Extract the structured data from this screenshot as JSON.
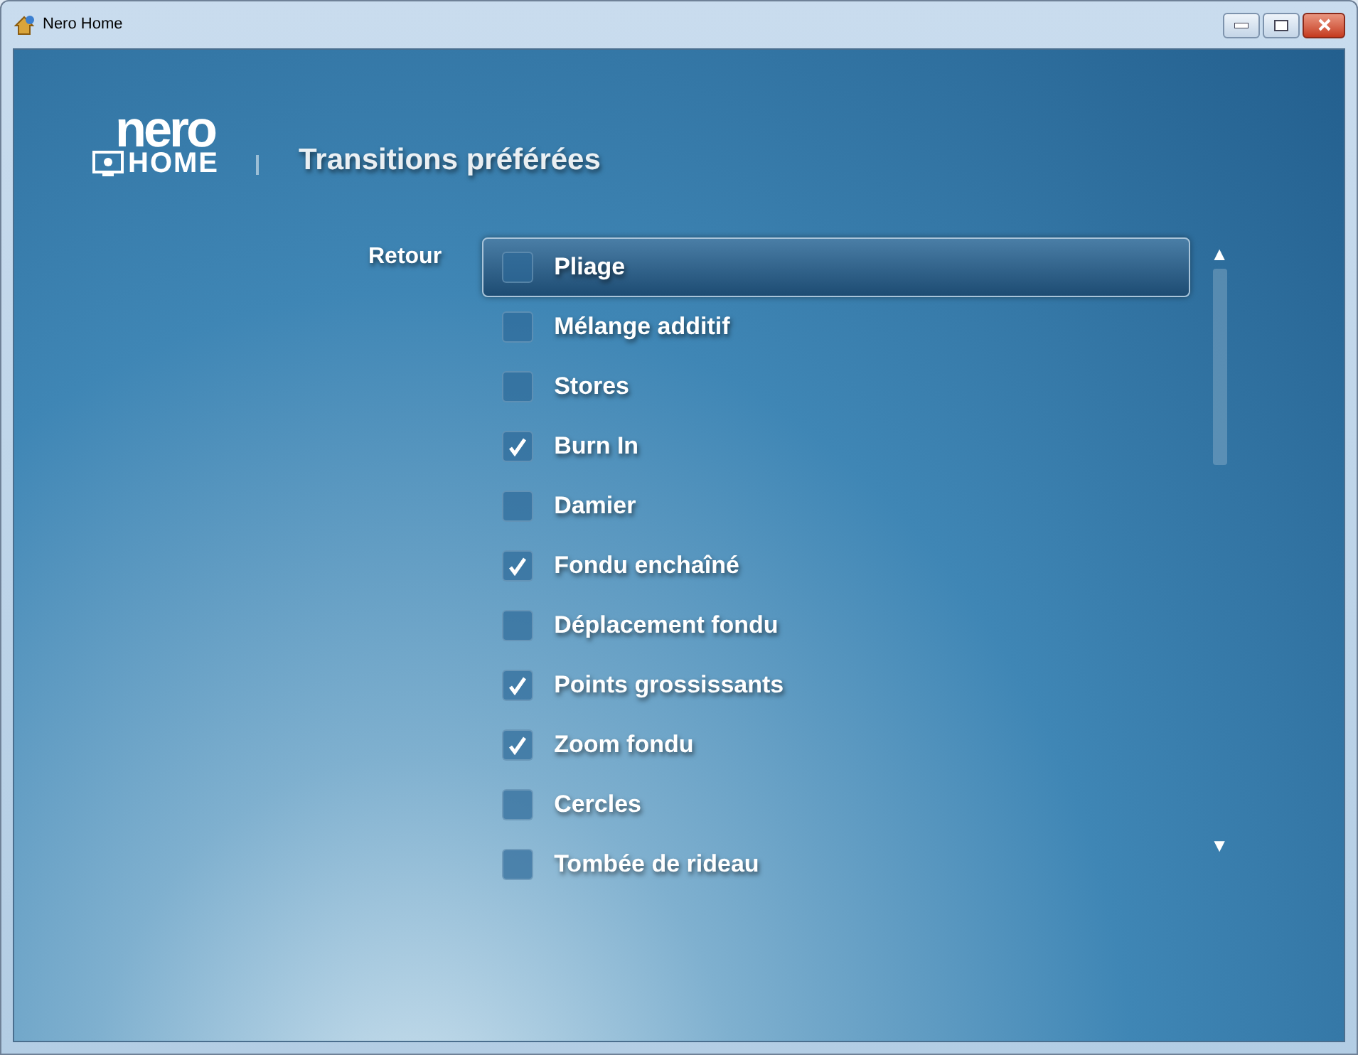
{
  "window": {
    "title": "Nero Home"
  },
  "logo": {
    "top": "nero",
    "bottom": "HOME"
  },
  "page_title": "Transitions préférées",
  "back": "Retour",
  "scroll": {
    "up": "▲",
    "down": "▼"
  },
  "items": [
    {
      "label": "Pliage",
      "checked": false,
      "selected": true
    },
    {
      "label": "Mélange additif",
      "checked": false,
      "selected": false
    },
    {
      "label": "Stores",
      "checked": false,
      "selected": false
    },
    {
      "label": "Burn In",
      "checked": true,
      "selected": false
    },
    {
      "label": "Damier",
      "checked": false,
      "selected": false
    },
    {
      "label": "Fondu enchaîné",
      "checked": true,
      "selected": false
    },
    {
      "label": "Déplacement fondu",
      "checked": false,
      "selected": false
    },
    {
      "label": "Points grossissants",
      "checked": true,
      "selected": false
    },
    {
      "label": "Zoom fondu",
      "checked": true,
      "selected": false
    },
    {
      "label": "Cercles",
      "checked": false,
      "selected": false
    },
    {
      "label": "Tombée de rideau",
      "checked": false,
      "selected": false
    }
  ]
}
